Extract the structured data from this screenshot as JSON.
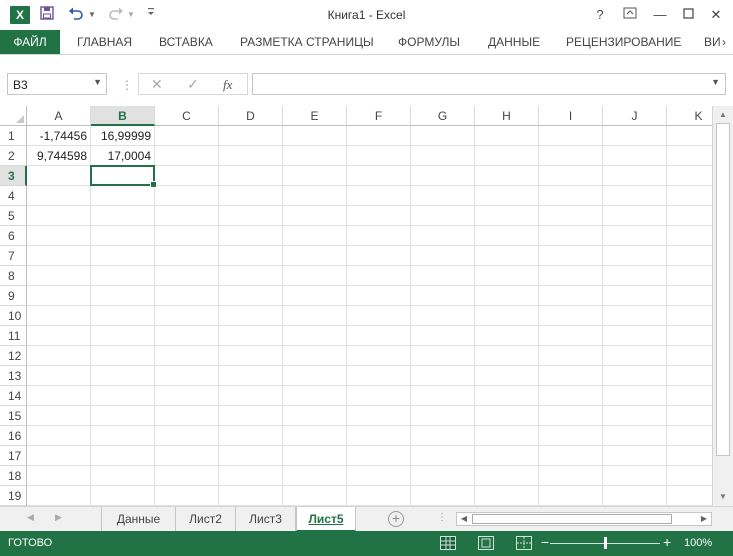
{
  "titlebar": {
    "title": "Книга1 - Excel",
    "logo_letter": "X",
    "help": "?",
    "minimize": "—",
    "close": "✕"
  },
  "ribbon": {
    "tabs": [
      "ФАЙЛ",
      "ГЛАВНАЯ",
      "ВСТАВКА",
      "РАЗМЕТКА СТРАНИЦЫ",
      "ФОРМУЛЫ",
      "ДАННЫЕ",
      "РЕЦЕНЗИРОВАНИЕ",
      "ВИ"
    ],
    "more": "›"
  },
  "formula_bar": {
    "name_box": "B3",
    "formula": "",
    "fx_label": "fx"
  },
  "grid": {
    "columns": [
      "A",
      "B",
      "C",
      "D",
      "E",
      "F",
      "G",
      "H",
      "I",
      "J",
      "K"
    ],
    "rows": [
      "1",
      "2",
      "3",
      "4",
      "5",
      "6",
      "7",
      "8",
      "9",
      "10",
      "11",
      "12",
      "13",
      "14",
      "15",
      "16",
      "17",
      "18",
      "19"
    ],
    "selected_column": "B",
    "selected_row": "3",
    "cells": {
      "A1": "-1,74456",
      "B1": "16,99999",
      "A2": "9,744598",
      "B2": "17,0004"
    }
  },
  "sheets": {
    "tabs": [
      "Данные",
      "Лист2",
      "Лист3",
      "Лист5"
    ],
    "active": "Лист5"
  },
  "status": {
    "text": "ГОТОВО",
    "zoom": "100%",
    "zoom_minus": "−",
    "zoom_plus": "+"
  },
  "colors": {
    "accent": "#217346"
  }
}
